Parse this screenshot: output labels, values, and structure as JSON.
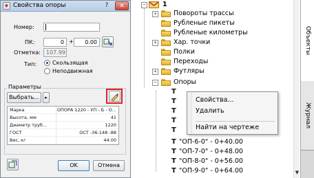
{
  "dialog": {
    "title": "Свойства опоры",
    "help": "?",
    "close": "✕",
    "number_label": "Номер:",
    "number_value": "",
    "pk_label": "ПК:",
    "pk_value": "0",
    "pk_plus": "+",
    "pk_offset": "0.00",
    "elevation_label": "Отметка:",
    "elevation_value": "107.99",
    "type_label": "Тип:",
    "type_options": [
      {
        "label": "Скользящая",
        "selected": true
      },
      {
        "label": "Неподвижная",
        "selected": false
      }
    ],
    "params_label": "Параметры",
    "choose_button": "Выбрать...",
    "arrow_button": "▸",
    "properties": [
      {
        "name": "Марка",
        "value": "ОПОРА 1220 - УП - Б - О..."
      },
      {
        "name": "Высота, мм",
        "value": "41"
      },
      {
        "name": "Диаметр труб...",
        "value": "1220"
      },
      {
        "name": "ГОСТ",
        "value": "ОСТ -36-148 -88"
      },
      {
        "name": "Вес, кг",
        "value": "44.00"
      }
    ],
    "ok_button": "OK",
    "cancel_button": "Отмена"
  },
  "tree": {
    "root_label": "1",
    "folders": [
      {
        "label": "Повороты трассы",
        "expander": "+"
      },
      {
        "label": "Рубленые пикеты",
        "expander": ""
      },
      {
        "label": "Рубленые километры",
        "expander": ""
      },
      {
        "label": "Хар. точки",
        "expander": "+"
      },
      {
        "label": "Полки",
        "expander": ""
      },
      {
        "label": "Переходы",
        "expander": ""
      },
      {
        "label": "Футляры",
        "expander": "+"
      },
      {
        "label": "Опоры",
        "expander": "−"
      }
    ],
    "supports": [
      {
        "label": "\"ОП-6-0\" - 0+40.00"
      },
      {
        "label": "\"ОП-7-0\" - 0+48.00"
      },
      {
        "label": "\"ОП-8-0\" - 0+56.00"
      },
      {
        "label": "\"ОП-9-0\" - 0+64.00"
      }
    ]
  },
  "context_menu": {
    "items": [
      "Свойства...",
      "Удалить",
      "Найти на чертеже"
    ]
  },
  "side_tabs": [
    "Объекты",
    "Журнал"
  ],
  "colors": {
    "highlight": "#e02020",
    "folder": "#f2c94c"
  }
}
